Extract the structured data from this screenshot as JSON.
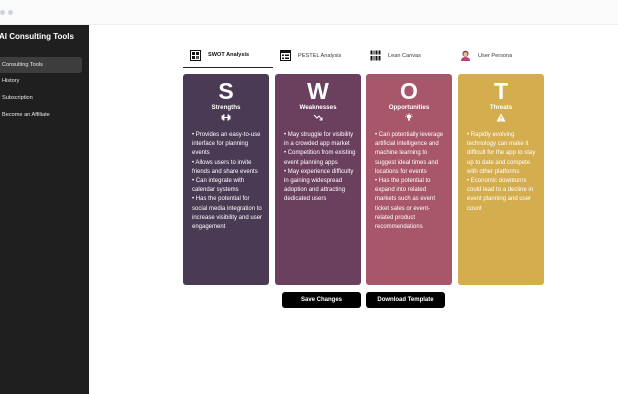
{
  "sidebar": {
    "title": "AI Consulting Tools",
    "items": [
      {
        "label": "Consulting Tools"
      },
      {
        "label": "History"
      },
      {
        "label": "Subscription"
      },
      {
        "label": "Become an Affiliate"
      }
    ]
  },
  "tabs": [
    {
      "label": "SWOT Analysis",
      "icon": "swot-icon",
      "active": true
    },
    {
      "label": "PESTEL Analysis",
      "icon": "pestel-icon"
    },
    {
      "label": "Lean Canvas",
      "icon": "lean-canvas-icon"
    },
    {
      "label": "User Persona",
      "icon": "user-persona-icon"
    }
  ],
  "swot": [
    {
      "letter": "S",
      "title": "Strengths",
      "icon": "dumbbell-icon",
      "color": "#4a3a54",
      "body": "• Provides an easy-to-use interface for planning events\n• Allows users to invite friends and share events\n• Can integrate with calendar systems\n• Has the potential for social media integration to increase visibility and user engagement"
    },
    {
      "letter": "W",
      "title": "Weaknesses",
      "icon": "trend-down-icon",
      "color": "#6b3f5e",
      "body": "• May struggle for visibility in a crowded app market\n• Competition from existing event planning apps\n• May experience difficulty in gaining widespread adoption and attracting dedicated users"
    },
    {
      "letter": "O",
      "title": "Opportunities",
      "icon": "lightbulb-icon",
      "color": "#a8566a",
      "body": "• Can potentially leverage artificial intelligence and machine learning to suggest ideal times and locations for events\n• Has the potential to expand into related markets such as event ticket sales or event-related product recommendations"
    },
    {
      "letter": "T",
      "title": "Threats",
      "icon": "warning-icon",
      "color": "#d4ad4f",
      "body": "• Rapidly evolving technology can make it difficult for the app to stay up to date and compete with other platforms\n• Economic downturns could lead to a decline in event planning and user count"
    }
  ],
  "actions": {
    "save_label": "Save Changes",
    "download_label": "Download Template"
  }
}
